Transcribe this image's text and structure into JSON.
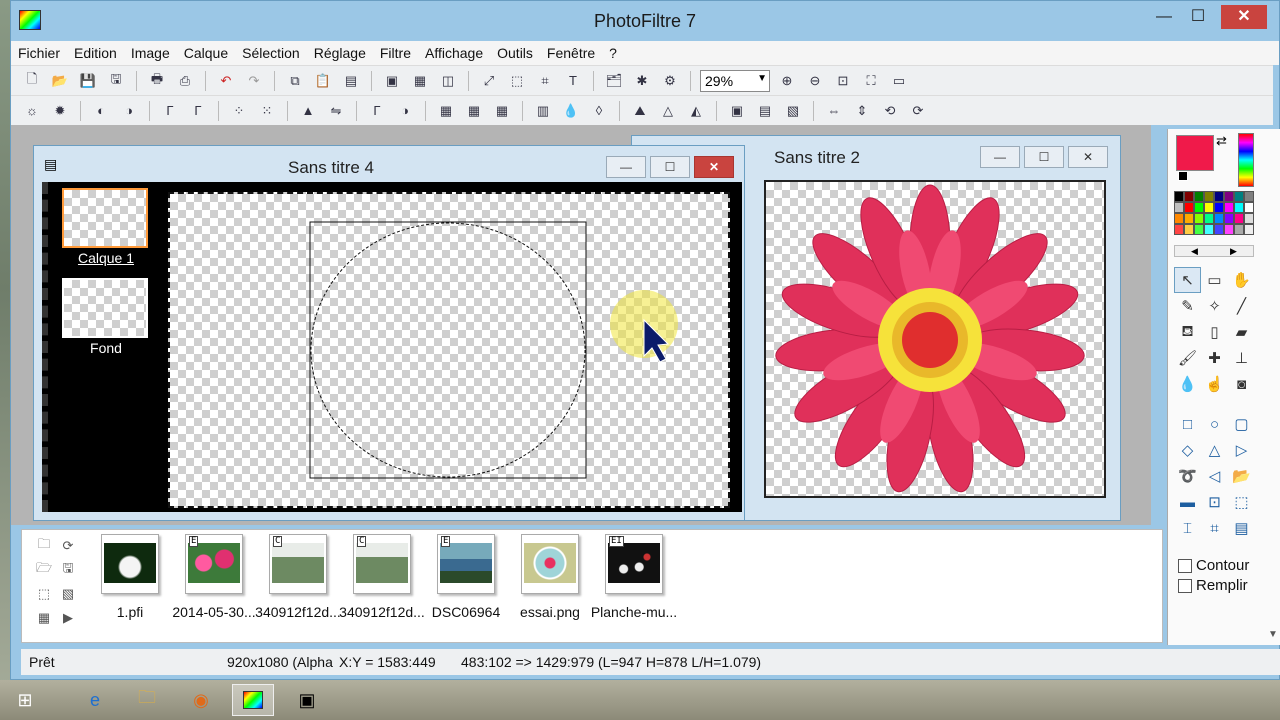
{
  "app": {
    "title": "PhotoFiltre 7"
  },
  "window_controls": {
    "minimize": "—",
    "maximize": "☐",
    "close": "✕"
  },
  "menu": [
    "Fichier",
    "Edition",
    "Image",
    "Calque",
    "Sélection",
    "Réglage",
    "Filtre",
    "Affichage",
    "Outils",
    "Fenêtre",
    "?"
  ],
  "toolbar": {
    "zoom_value": "29%"
  },
  "documents": {
    "doc1": {
      "title": "Sans titre 4",
      "layers": [
        {
          "label": "Calque 1"
        },
        {
          "label": "Fond"
        }
      ]
    },
    "doc2": {
      "title": "Sans titre 2"
    }
  },
  "side_panel": {
    "contour_label": "Contour",
    "remplir_label": "Remplir",
    "fg_color": "#f01a4a"
  },
  "files": [
    {
      "name": "1.pfi",
      "badge": "",
      "theme": "#0e2a0e"
    },
    {
      "name": "2014-05-30...",
      "badge": "E",
      "theme": "#d84a78"
    },
    {
      "name": "340912f12d...",
      "badge": "C",
      "theme": "#6d8a62"
    },
    {
      "name": "340912f12d...",
      "badge": "C",
      "theme": "#6d8a62"
    },
    {
      "name": "DSC06964",
      "badge": "E",
      "theme": "#3a6a90"
    },
    {
      "name": "essai.png",
      "badge": "",
      "theme": "#9fd4d8"
    },
    {
      "name": "Planche-mu...",
      "badge": "EI",
      "theme": "#111111"
    }
  ],
  "status": {
    "ready": "Prêt",
    "info": "920x1080 (Alpha",
    "xy": "X:Y = 1583:449",
    "selection": "483:102 => 1429:979 (L=947  H=878  L/H=1.079)"
  }
}
